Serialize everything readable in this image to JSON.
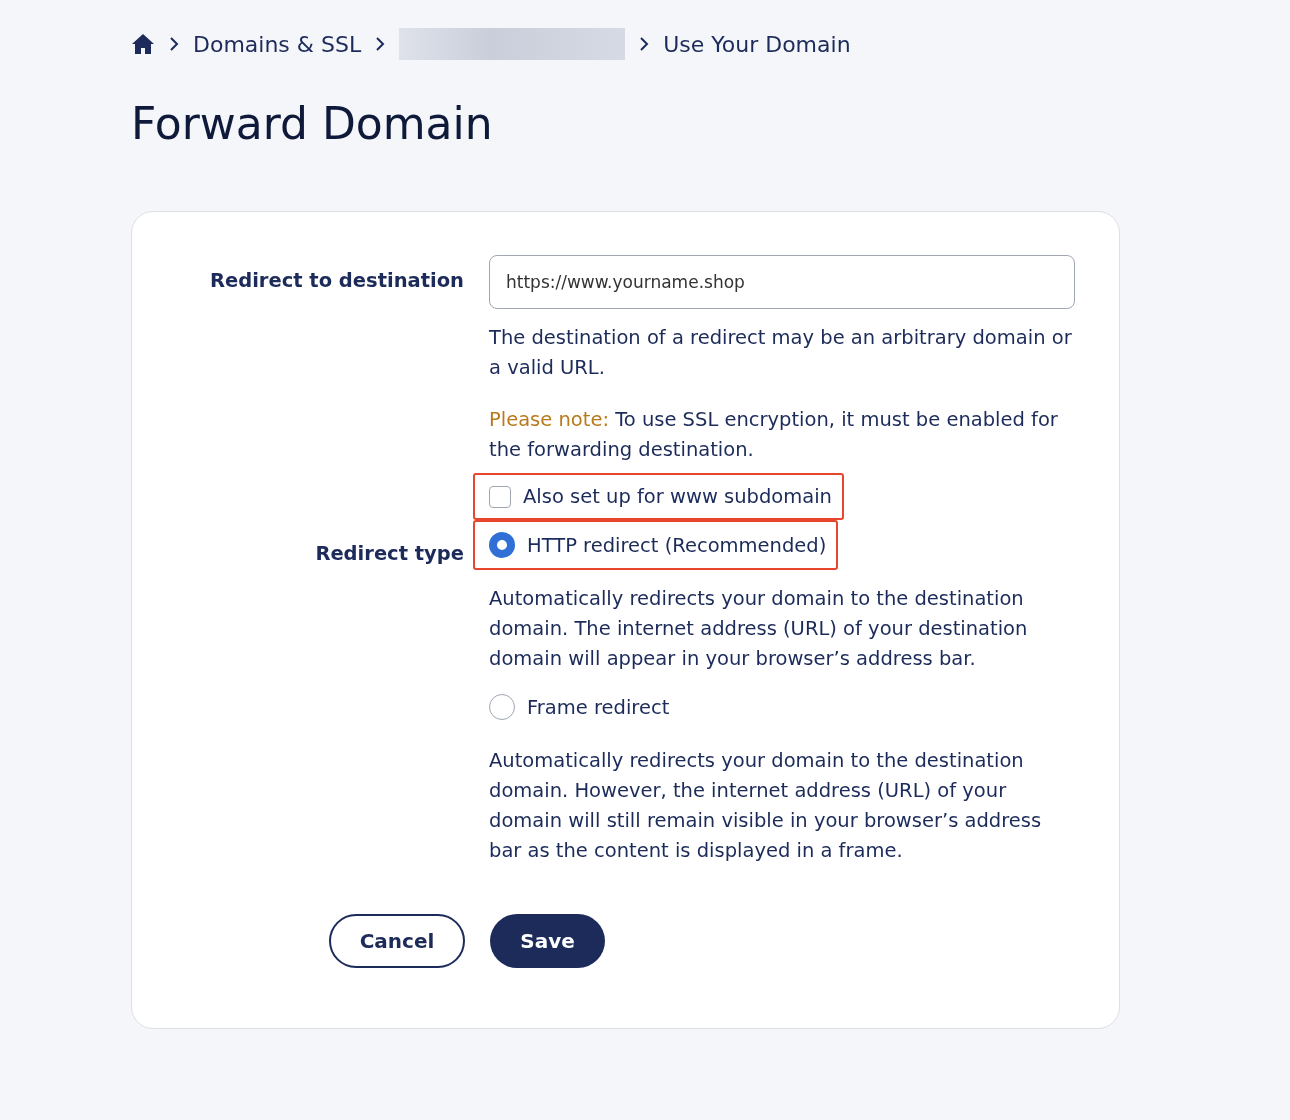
{
  "breadcrumb": [
    {
      "kind": "home"
    },
    {
      "kind": "link",
      "label": "Domains & SSL"
    },
    {
      "kind": "redacted"
    },
    {
      "kind": "text",
      "label": "Use Your Domain"
    }
  ],
  "title": "Forward Domain",
  "destination": {
    "label": "Redirect to destination",
    "value": "https://www.yourname.shop",
    "help": "The destination of a redirect may be an arbitrary domain or a valid URL.",
    "note_label": "Please note:",
    "note": "To use SSL encryption, it must be enabled for the forwarding destination."
  },
  "www_checkbox": {
    "label": "Also set up for www subdomain",
    "checked": false,
    "highlighted": true
  },
  "redirect_type": {
    "label": "Redirect type",
    "options": [
      {
        "label": "HTTP redirect (Recommended)",
        "selected": true,
        "highlighted": true,
        "description": "Automatically redirects your domain to the destination domain. The internet address (URL) of your destination domain will appear in your browser’s address bar."
      },
      {
        "label": "Frame redirect",
        "selected": false,
        "highlighted": false,
        "description": "Automatically redirects your domain to the destination domain. However, the internet address (URL) of your domain will still remain visible in your browser’s address bar as the content is displayed in a frame."
      }
    ]
  },
  "buttons": {
    "cancel": "Cancel",
    "save": "Save"
  }
}
